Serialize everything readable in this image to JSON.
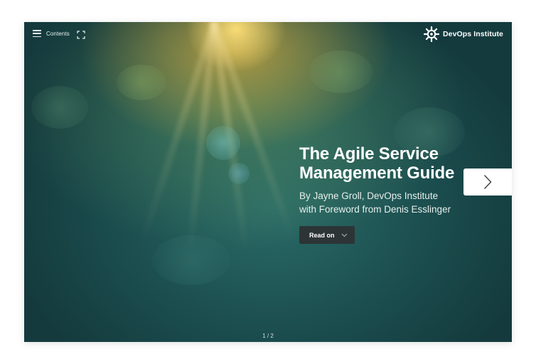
{
  "toolbar": {
    "contents_label": "Contents",
    "menu_icon": "hamburger-icon",
    "fullscreen_icon": "fullscreen-icon"
  },
  "brand": {
    "name": "DevOps Institute",
    "logo_icon": "devops-institute-logo"
  },
  "hero": {
    "title_line1": "The Agile Service",
    "title_line2": "Management Guide",
    "byline_line1": "By Jayne Groll, DevOps Institute",
    "byline_line2": "with Foreword from Denis Esslinger"
  },
  "actions": {
    "read_on_label": "Read on",
    "read_on_icon": "chevron-down-icon",
    "next_icon": "chevron-right-icon"
  },
  "pager": {
    "text": "1 / 2"
  },
  "colors": {
    "button_dark": "#2d3435",
    "text_light": "#ffffff",
    "background_teal": "#1c4f50"
  }
}
